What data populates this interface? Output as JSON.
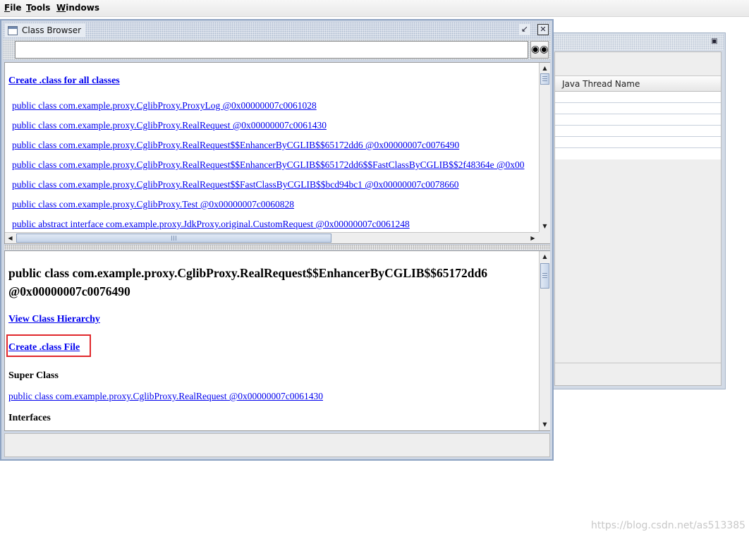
{
  "menubar": {
    "items": [
      {
        "label": "File",
        "mnemonic": "F",
        "rest": "ile"
      },
      {
        "label": "Tools",
        "mnemonic": "T",
        "rest": "ools"
      },
      {
        "label": "Windows",
        "mnemonic": "W",
        "rest": "indows"
      }
    ]
  },
  "class_browser": {
    "title": "Class Browser",
    "search": {
      "value": "",
      "placeholder": ""
    },
    "search_button_icon": "binoculars-icon",
    "create_all_label": "Create .class for all classes",
    "classes": [
      "public class com.example.proxy.CglibProxy.ProxyLog @0x00000007c0061028",
      "public class com.example.proxy.CglibProxy.RealRequest @0x00000007c0061430",
      "public class com.example.proxy.CglibProxy.RealRequest$$EnhancerByCGLIB$$65172dd6 @0x00000007c0076490",
      "public class com.example.proxy.CglibProxy.RealRequest$$EnhancerByCGLIB$$65172dd6$$FastClassByCGLIB$$2f48364e @0x00",
      "public class com.example.proxy.CglibProxy.RealRequest$$FastClassByCGLIB$$bcd94bc1 @0x00000007c0078660",
      "public class com.example.proxy.CglibProxy.Test @0x00000007c0060828",
      "public abstract interface com.example.proxy.JdkProxy.original.CustomRequest @0x00000007c0061248"
    ],
    "detail": {
      "heading": "public class com.example.proxy.CglibProxy.RealRequest$$EnhancerByCGLIB$$65172dd6 @0x00000007c0076490",
      "view_hierarchy_label": "View Class Hierarchy",
      "create_class_file_label": "Create .class File",
      "super_class_label": "Super Class",
      "super_class_link": "public class com.example.proxy.CglibProxy.RealRequest @0x00000007c0061430",
      "interfaces_label": "Interfaces"
    }
  },
  "thread_window": {
    "column_header": "Java Thread Name"
  },
  "watermark": "https://blog.csdn.net/as513385",
  "colors": {
    "link": "#0000ee",
    "highlight": "#e0282c",
    "window_border": "#8ea3c2"
  }
}
